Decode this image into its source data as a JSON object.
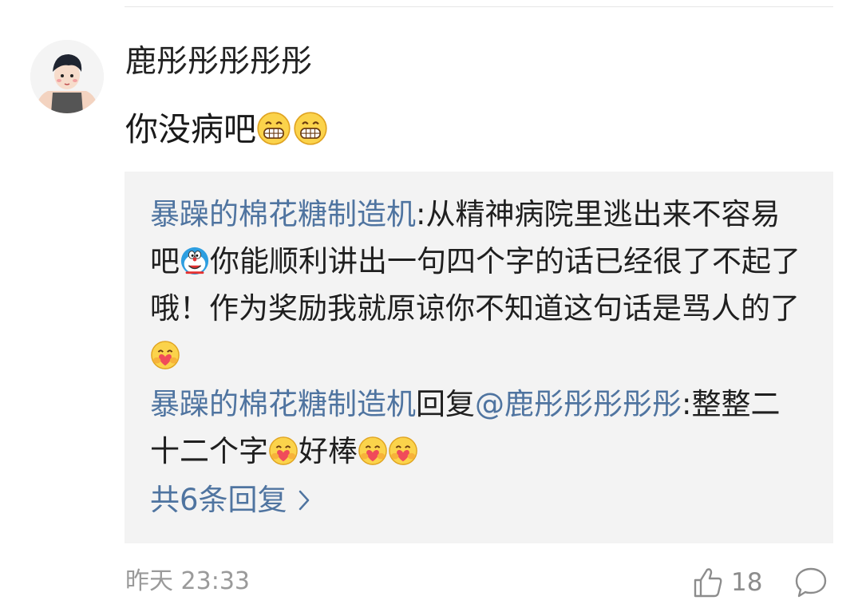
{
  "comment": {
    "username": "鹿彤彤彤彤彤",
    "text": "你没病吧",
    "timestamp": "昨天 23:33",
    "like_count": "18"
  },
  "replies": [
    {
      "author": "暴躁的棉花糖制造机",
      "text_part1": ":从精神病院里逃出来不容易吧",
      "text_part2": "你能顺利讲出一句四个字的话已经很了不起了哦！作为奖励我就原谅你不知道这句话是骂人的了"
    },
    {
      "author": "暴躁的棉花糖制造机",
      "connector": "回复",
      "mention": "@鹿彤彤彤彤彤",
      "text_part1": ":整整二十二个字",
      "text_part2": "好棒"
    }
  ],
  "more_replies_label": "共6条回复",
  "icons": {
    "grin": "grinning-face-emoji",
    "doraemon": "doraemon-emoji",
    "heart_hug": "heart-hug-emoji",
    "thumbs_up": "thumbs-up-icon",
    "comment": "comment-bubble-icon",
    "chevron": "chevron-right-icon"
  },
  "colors": {
    "link": "#4f74a0",
    "reply_bg": "#f3f3f3",
    "meta": "#9a9a9a"
  }
}
